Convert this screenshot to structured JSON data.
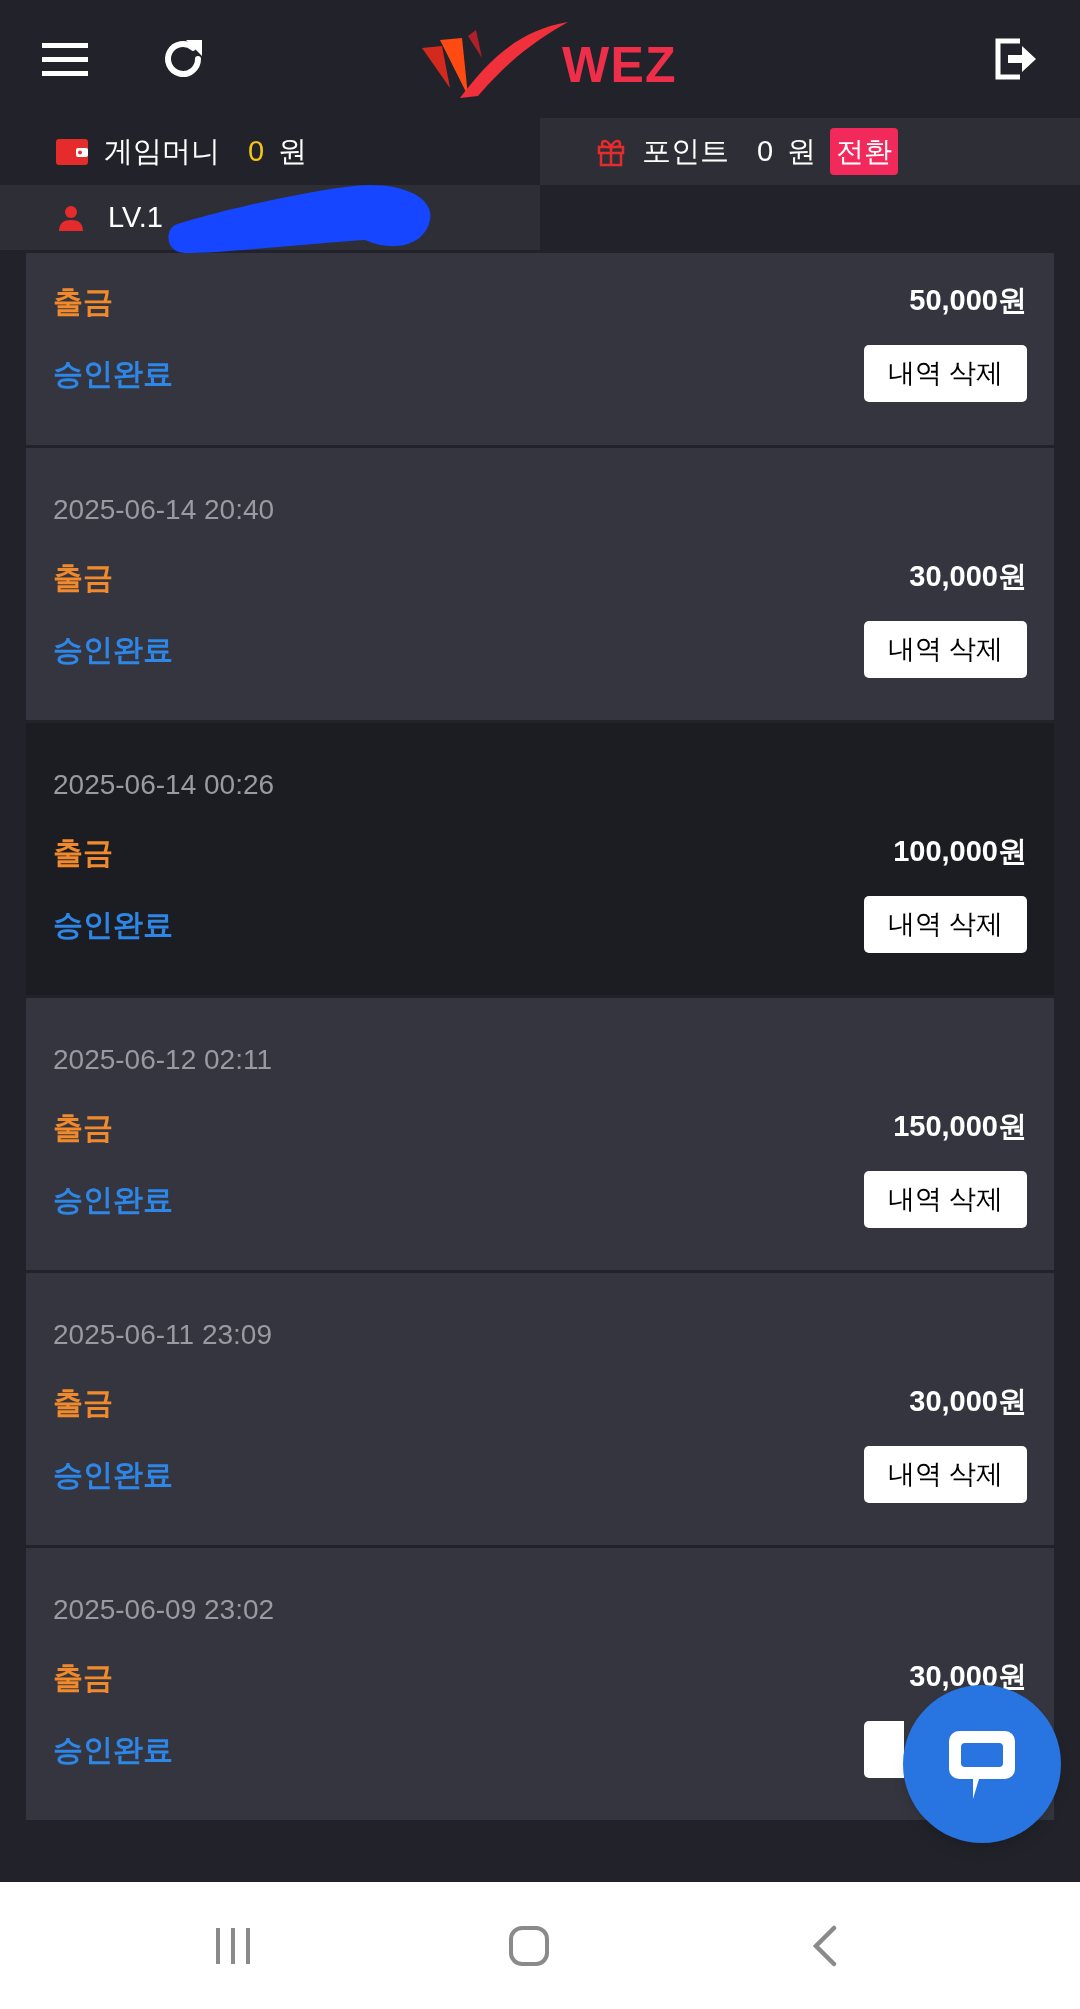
{
  "header": {
    "logo_text": "WEZ"
  },
  "wallet": {
    "label": "게임머니",
    "value": "0",
    "unit": "원"
  },
  "points": {
    "label": "포인트",
    "value": "0",
    "unit": "원",
    "button": "전환"
  },
  "user": {
    "level": "LV.1"
  },
  "transactions": [
    {
      "type": "출금",
      "amount": "50,000원",
      "status": "승인완료",
      "button": "내역 삭제",
      "highlighted": true
    },
    {
      "date": "2025-06-14 20:40",
      "type": "출금",
      "amount": "30,000원",
      "status": "승인완료",
      "button": "내역 삭제",
      "highlighted": true
    },
    {
      "date": "2025-06-14 00:26",
      "type": "출금",
      "amount": "100,000원",
      "status": "승인완료",
      "button": "내역 삭제",
      "highlighted": false
    },
    {
      "date": "2025-06-12 02:11",
      "type": "출금",
      "amount": "150,000원",
      "status": "승인완료",
      "button": "내역 삭제",
      "highlighted": true
    },
    {
      "date": "2025-06-11 23:09",
      "type": "출금",
      "amount": "30,000원",
      "status": "승인완료",
      "button": "내역 삭제",
      "highlighted": true
    },
    {
      "date": "2025-06-09 23:02",
      "type": "출금",
      "amount": "30,000원",
      "status": "승인완료",
      "button_covered": true,
      "highlighted": true
    }
  ]
}
